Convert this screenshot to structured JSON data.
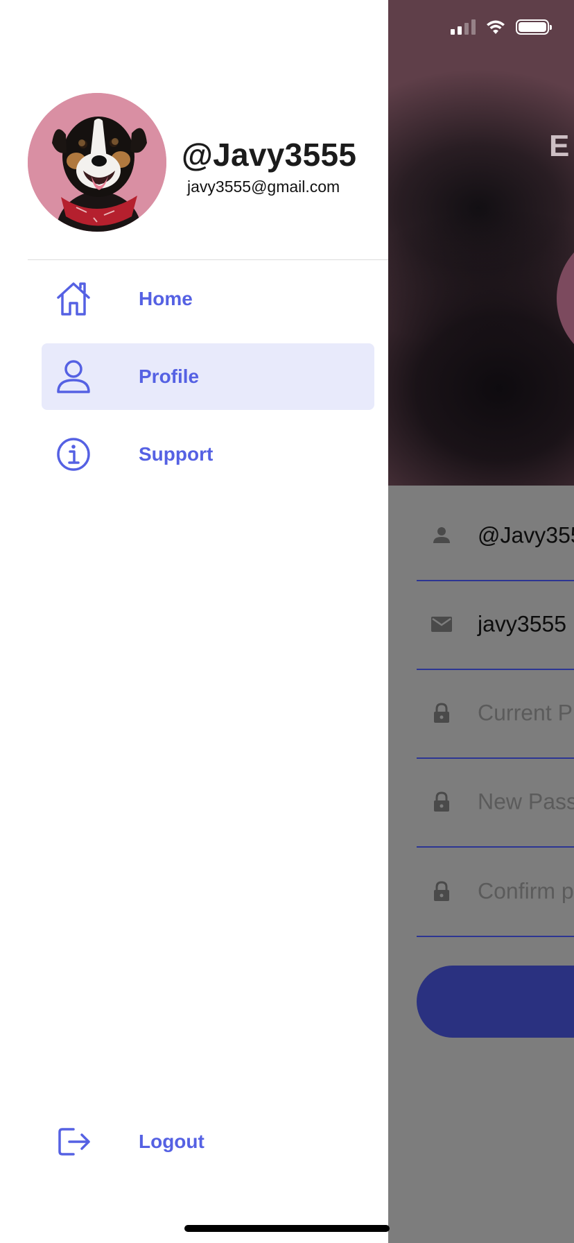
{
  "colors": {
    "accent": "#5561e3",
    "active_bg": "#e8eafb",
    "field_underline": "#2c3593",
    "hero_bg": "#5f3f49",
    "page_dim": "#7d7d7d"
  },
  "drawer": {
    "username": "@Javy3555",
    "email": "javy3555@gmail.com",
    "avatar_icon": "dog-avatar",
    "nav": [
      {
        "label": "Home",
        "icon": "home-icon",
        "active": false
      },
      {
        "label": "Profile",
        "icon": "user-icon",
        "active": true
      },
      {
        "label": "Support",
        "icon": "info-icon",
        "active": false
      }
    ],
    "logout": {
      "label": "Logout",
      "icon": "logout-icon"
    }
  },
  "background_page": {
    "hero_title": "E",
    "fields": [
      {
        "icon": "person-icon",
        "value": "@Javy355",
        "kind": "value"
      },
      {
        "icon": "mail-icon",
        "value": "javy3555",
        "kind": "value"
      },
      {
        "icon": "lock-icon",
        "placeholder": "Current P",
        "kind": "placeholder"
      },
      {
        "icon": "lock-icon",
        "placeholder": "New Pass",
        "kind": "placeholder"
      },
      {
        "icon": "lock-icon",
        "placeholder": "Confirm p",
        "kind": "placeholder"
      }
    ]
  }
}
